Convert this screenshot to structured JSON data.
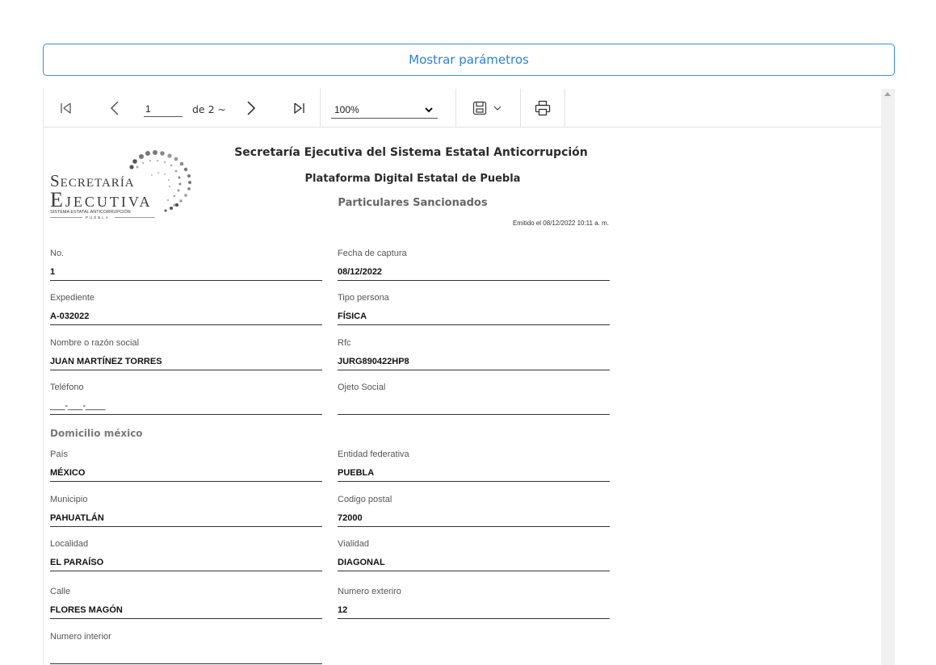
{
  "params_button": "Mostrar parámetros",
  "toolbar": {
    "page_current": "1",
    "page_of": "de 2 ~",
    "zoom": "100%"
  },
  "report": {
    "logo": {
      "line1": "Secretaría",
      "line2": "Ejecutiva",
      "line3": "SISTEMA ESTATAL ANTICORRUPCIÓN",
      "line4": "PUEBLA"
    },
    "title": "Secretaría Ejecutiva del Sistema Estatal Anticorrupción",
    "subtitle": "Plataforma Digital Estatal de Puebla",
    "section_title": "Particulares Sancionados",
    "emitted": "Emitido el 08/12/2022 10:11 a. m.",
    "fields": {
      "no": {
        "label": "No.",
        "value": "1"
      },
      "fecha": {
        "label": "Fecha de captura",
        "value": "08/12/2022"
      },
      "expediente": {
        "label": "Expediente",
        "value": "A-032022"
      },
      "tipo": {
        "label": "Tipo persona",
        "value": "FÍSICA"
      },
      "nombre": {
        "label": "Nombre o razón social",
        "value": "JUAN MARTÍNEZ TORRES"
      },
      "rfc": {
        "label": "Rfc",
        "value": "JURG890422HP8"
      },
      "telefono": {
        "label": "Teléfono",
        "value": "___-___-____"
      },
      "objeto": {
        "label": "Ojeto Social",
        "value": ""
      },
      "pais": {
        "label": "País",
        "value": "MÉXICO"
      },
      "entidad": {
        "label": "Entidad federativa",
        "value": "PUEBLA"
      },
      "municipio": {
        "label": "Municipio",
        "value": "PAHUATLÁN"
      },
      "cp": {
        "label": "Codigo postal",
        "value": "72000"
      },
      "localidad": {
        "label": "Localidad",
        "value": "EL PARAÍSO"
      },
      "vialidad": {
        "label": "Vialidad",
        "value": "DIAGONAL"
      },
      "calle": {
        "label": "Calle",
        "value": "FLORES MAGÓN"
      },
      "num_ext": {
        "label": "Numero exteriro",
        "value": "12"
      },
      "num_int": {
        "label": "Numero interior",
        "value": ""
      }
    },
    "domicilio_heading": "Domicilio méxico"
  }
}
